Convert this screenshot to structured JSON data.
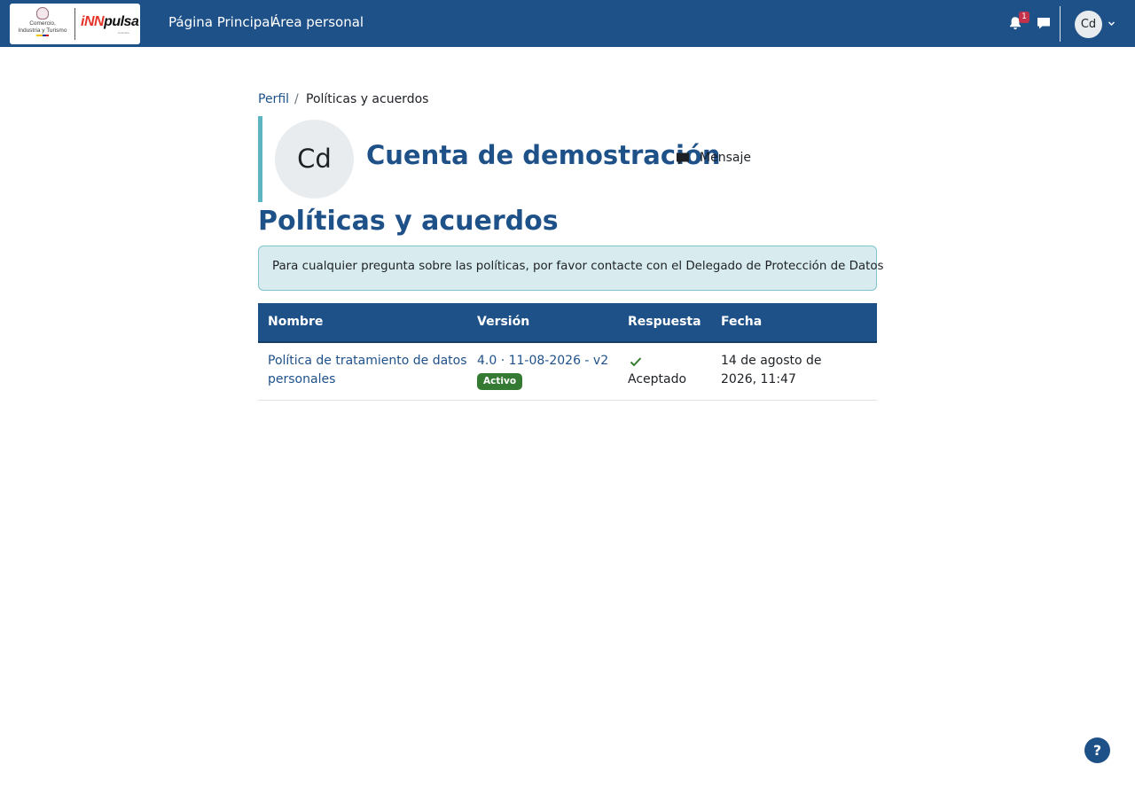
{
  "nav": {
    "logo": {
      "line1": "Comercio,",
      "line2": "Industria y Turismo",
      "brand_inn": "iNN",
      "brand_pulsa": "pulsa",
      "brand_sub": "Colombia"
    },
    "links": [
      "Página Principal",
      "Área personal"
    ],
    "notification_count": "1",
    "user_initials": "Cd",
    "icons": [
      "bell-icon",
      "chat-icon",
      "chevron-down-icon"
    ]
  },
  "breadcrumb": {
    "parent": "Perfil",
    "separator": "/",
    "current": "Políticas y acuerdos"
  },
  "profile": {
    "initials": "Cd",
    "name": "Cuenta de demostración",
    "message_label": "Mensaje",
    "message_icon": "chat-icon"
  },
  "page": {
    "title": "Políticas y acuerdos"
  },
  "info": {
    "text": "Para cualquier pregunta sobre las políticas, por favor contacte con el Delegado de Protección de Datos"
  },
  "table": {
    "headers": [
      "Nombre",
      "Versión",
      "Respuesta",
      "Fecha"
    ],
    "rows": [
      {
        "name": "Política de tratamiento de datos personales",
        "version": "4.0 · 11-08-2026 - v2",
        "badge": "Activo",
        "response_icon": "check-icon",
        "response": "Aceptado",
        "date": "14 de agosto de 2026, 11:47"
      }
    ]
  },
  "help": {
    "label": "?"
  },
  "colors": {
    "primary": "#1f5189",
    "accent": "#5eb5c2",
    "alert_bg": "#d8ecef",
    "badge_success": "#357a32",
    "notification": "#c4314b"
  }
}
